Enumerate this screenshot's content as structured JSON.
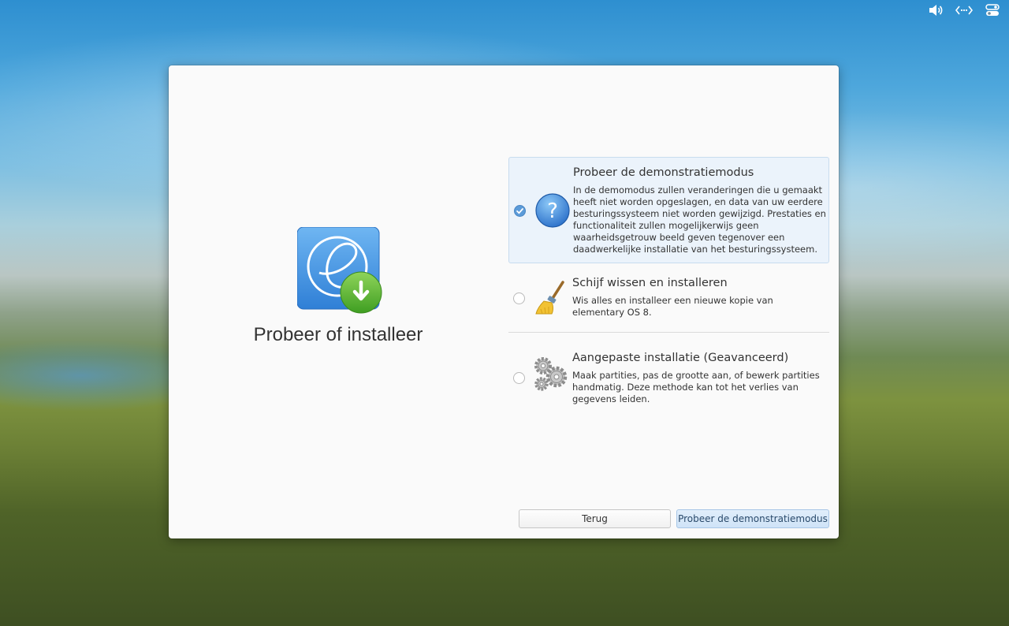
{
  "tray": {
    "icons": [
      "volume-icon",
      "network-icon",
      "system-toggle-icon"
    ]
  },
  "dialog": {
    "title": "Probeer of installeer",
    "logo": "elementary-installer-logo",
    "options": [
      {
        "title": "Probeer de demonstratiemodus",
        "description": "In de demomodus zullen veranderingen die u gemaakt heeft niet worden opgeslagen, en data van uw eerdere besturingssysteem niet worden gewijzigd. Prestaties en functionaliteit zullen mogelijkerwijs geen waarheidsgetrouw beeld geven tegenover een daadwerkelijke installatie van het besturingssysteem.",
        "icon": "help-icon",
        "selected": true
      },
      {
        "title": "Schijf wissen en installeren",
        "description": "Wis alles en installeer een nieuwe kopie van elementary OS 8.",
        "icon": "broom-icon",
        "selected": false
      },
      {
        "title": "Aangepaste installatie (Geavanceerd)",
        "description": "Maak partities, pas de grootte aan, of bewerk partities handmatig. Deze methode kan tot het verlies van gegevens leiden.",
        "icon": "gears-icon",
        "selected": false
      }
    ],
    "buttons": {
      "back": "Terug",
      "next": "Probeer de demonstratiemodus"
    }
  },
  "colors": {
    "accent": "#5b9bd9",
    "selected_bg": "#ebf3fb",
    "install_green": "#4fae2e"
  }
}
